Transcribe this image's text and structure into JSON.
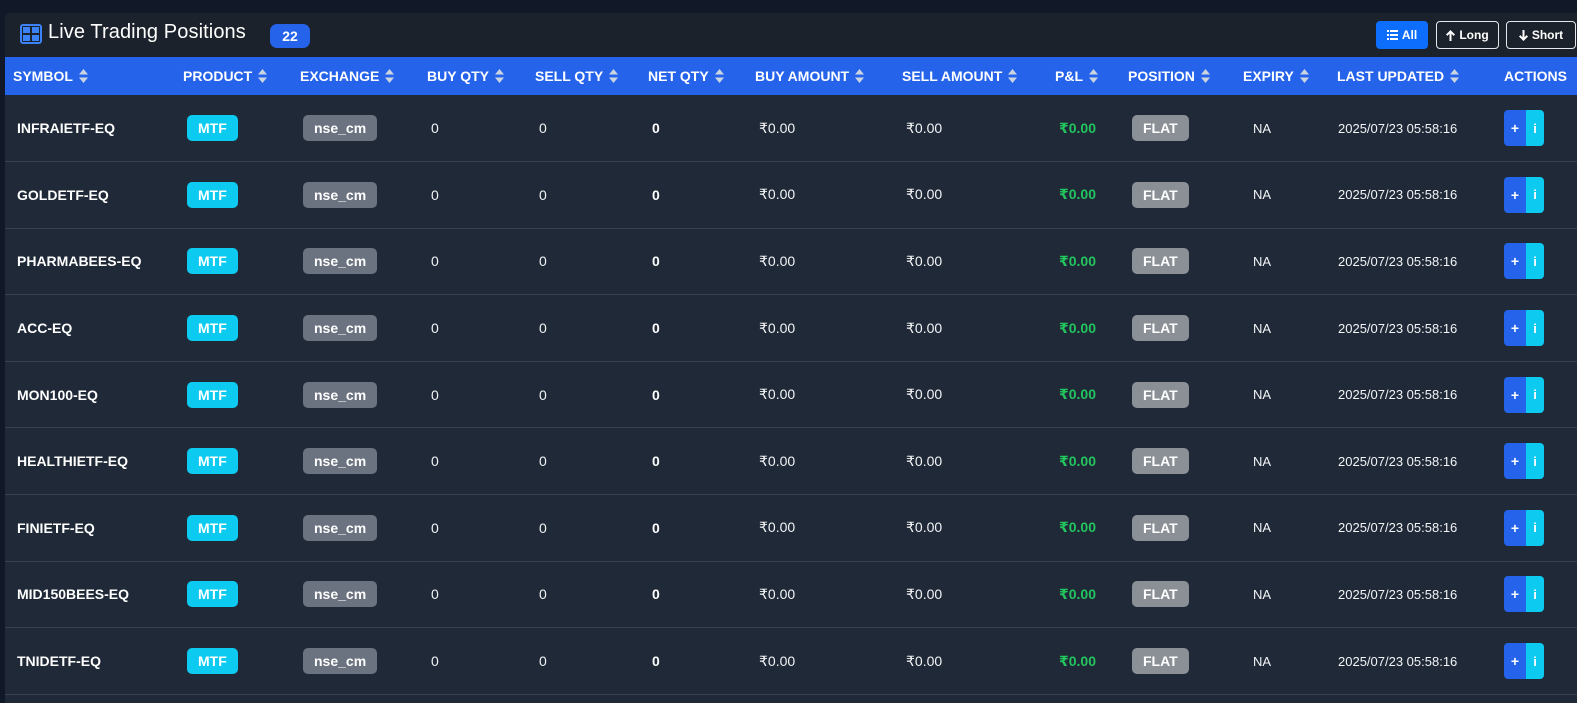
{
  "header": {
    "title": "Live Trading Positions",
    "count": "22",
    "filters": {
      "all": "All",
      "long": "Long",
      "short": "Short"
    }
  },
  "columns": [
    "SYMBOL",
    "PRODUCT",
    "EXCHANGE",
    "BUY QTY",
    "SELL QTY",
    "NET QTY",
    "BUY AMOUNT",
    "SELL AMOUNT",
    "P&L",
    "POSITION",
    "EXPIRY",
    "LAST UPDATED",
    "ACTIONS"
  ],
  "rows": [
    {
      "symbol": "INFRAIETF-EQ",
      "product": "MTF",
      "exchange": "nse_cm",
      "buy_qty": "0",
      "sell_qty": "0",
      "net_qty": "0",
      "buy_amount": "₹0.00",
      "sell_amount": "₹0.00",
      "pnl": "₹0.00",
      "position": "FLAT",
      "expiry": "NA",
      "last_updated": "2025/07/23 05:58:16"
    },
    {
      "symbol": "GOLDETF-EQ",
      "product": "MTF",
      "exchange": "nse_cm",
      "buy_qty": "0",
      "sell_qty": "0",
      "net_qty": "0",
      "buy_amount": "₹0.00",
      "sell_amount": "₹0.00",
      "pnl": "₹0.00",
      "position": "FLAT",
      "expiry": "NA",
      "last_updated": "2025/07/23 05:58:16"
    },
    {
      "symbol": "PHARMABEES-EQ",
      "product": "MTF",
      "exchange": "nse_cm",
      "buy_qty": "0",
      "sell_qty": "0",
      "net_qty": "0",
      "buy_amount": "₹0.00",
      "sell_amount": "₹0.00",
      "pnl": "₹0.00",
      "position": "FLAT",
      "expiry": "NA",
      "last_updated": "2025/07/23 05:58:16"
    },
    {
      "symbol": "ACC-EQ",
      "product": "MTF",
      "exchange": "nse_cm",
      "buy_qty": "0",
      "sell_qty": "0",
      "net_qty": "0",
      "buy_amount": "₹0.00",
      "sell_amount": "₹0.00",
      "pnl": "₹0.00",
      "position": "FLAT",
      "expiry": "NA",
      "last_updated": "2025/07/23 05:58:16"
    },
    {
      "symbol": "MON100-EQ",
      "product": "MTF",
      "exchange": "nse_cm",
      "buy_qty": "0",
      "sell_qty": "0",
      "net_qty": "0",
      "buy_amount": "₹0.00",
      "sell_amount": "₹0.00",
      "pnl": "₹0.00",
      "position": "FLAT",
      "expiry": "NA",
      "last_updated": "2025/07/23 05:58:16"
    },
    {
      "symbol": "HEALTHIETF-EQ",
      "product": "MTF",
      "exchange": "nse_cm",
      "buy_qty": "0",
      "sell_qty": "0",
      "net_qty": "0",
      "buy_amount": "₹0.00",
      "sell_amount": "₹0.00",
      "pnl": "₹0.00",
      "position": "FLAT",
      "expiry": "NA",
      "last_updated": "2025/07/23 05:58:16"
    },
    {
      "symbol": "FINIETF-EQ",
      "product": "MTF",
      "exchange": "nse_cm",
      "buy_qty": "0",
      "sell_qty": "0",
      "net_qty": "0",
      "buy_amount": "₹0.00",
      "sell_amount": "₹0.00",
      "pnl": "₹0.00",
      "position": "FLAT",
      "expiry": "NA",
      "last_updated": "2025/07/23 05:58:16"
    },
    {
      "symbol": "MID150BEES-EQ",
      "product": "MTF",
      "exchange": "nse_cm",
      "buy_qty": "0",
      "sell_qty": "0",
      "net_qty": "0",
      "buy_amount": "₹0.00",
      "sell_amount": "₹0.00",
      "pnl": "₹0.00",
      "position": "FLAT",
      "expiry": "NA",
      "last_updated": "2025/07/23 05:58:16"
    },
    {
      "symbol": "TNIDETF-EQ",
      "product": "MTF",
      "exchange": "nse_cm",
      "buy_qty": "0",
      "sell_qty": "0",
      "net_qty": "0",
      "buy_amount": "₹0.00",
      "sell_amount": "₹0.00",
      "pnl": "₹0.00",
      "position": "FLAT",
      "expiry": "NA",
      "last_updated": "2025/07/23 05:58:16"
    }
  ],
  "actions": {
    "add": "+",
    "info": "i"
  },
  "icons": {
    "title": "table-icon",
    "all": "list-icon",
    "long": "arrow-up-icon",
    "short": "arrow-down-icon",
    "sort": "sort-icon"
  },
  "colors": {
    "accent": "#2563eb",
    "info": "#0dcaf0",
    "profit": "#22c55e",
    "flat": "#8b9096"
  }
}
